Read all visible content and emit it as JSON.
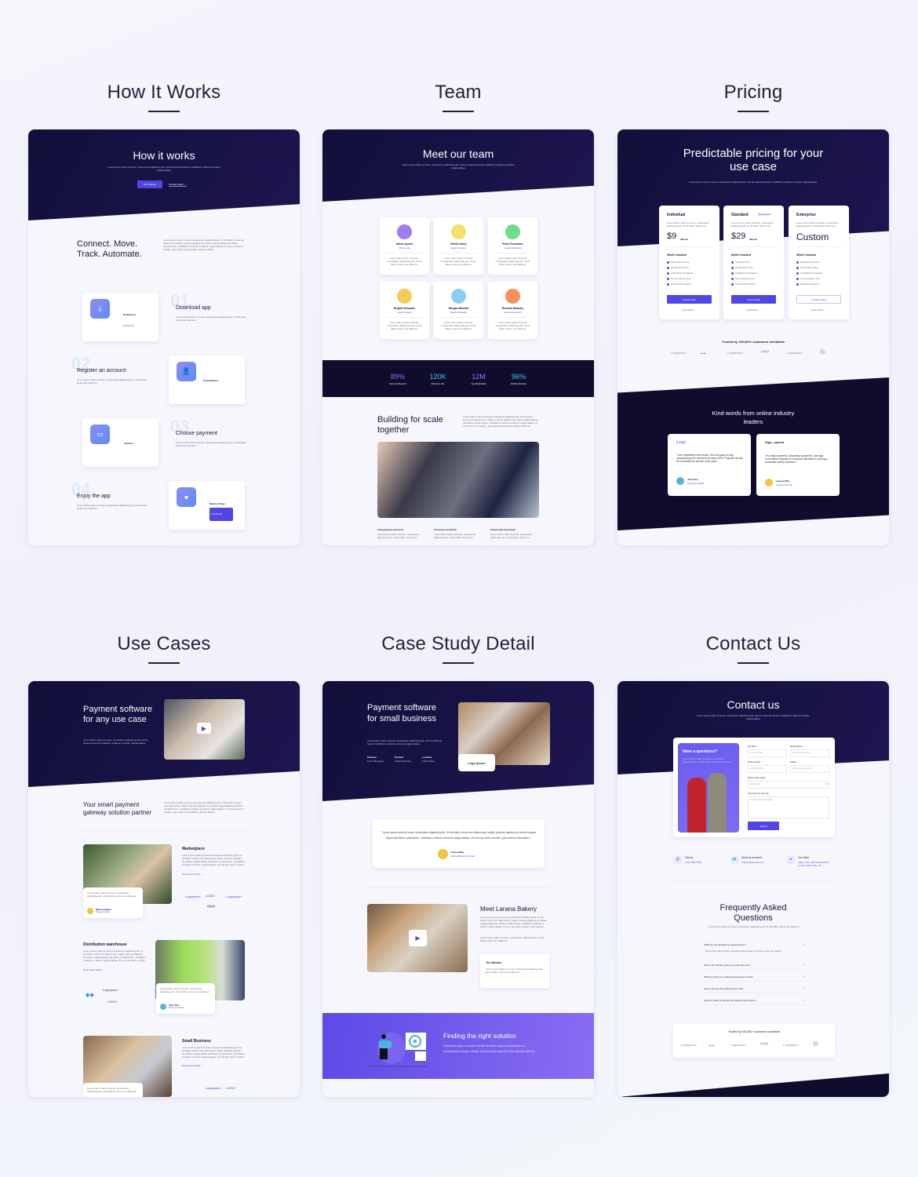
{
  "sections": [
    "How It Works",
    "Team",
    "Pricing",
    "Use Cases",
    "Case Study Detail",
    "Contact Us"
  ],
  "lorem": "Lorem ipsum dolor sit amet, consectetur adipiscing elit, sed do eiusmod tempor incididunt ut labore et dolore magna aliqua.",
  "lorem_long": "Lorem ipsum dolor sit amet consectetur adipiscing elit. Ut elit tellus, luctus nec ullamcorper mattis, pulvinar dapibus leo dolore magna aliqua erat libero condimentum. Incididunt ut labore et dolore magna aliqua. Ut enim ad minim veniam, quis nostrud exercitation ullamco laboris.",
  "lorem_short": "Lorem ipsum dolor sit amet, consectetur adipiscing elit. Ut elit tellus, luctus nec ullamcor.",
  "accent": "#5146e5",
  "how": {
    "title": "How it works",
    "get_started": "Get Started",
    "contact_sales": "Contact Sales →",
    "headline": "Connect. Move. Track. Automate.",
    "steps": [
      {
        "num": "01",
        "title": "Download app",
        "icon": "download-icon"
      },
      {
        "num": "02",
        "title": "Register an account",
        "icon": "user-icon"
      },
      {
        "num": "03",
        "title": "Choose payment",
        "icon": "card-icon"
      },
      {
        "num": "04",
        "title": "Enjoy the app",
        "icon": "heart-icon"
      }
    ],
    "mock": {
      "dashboard": "Dashboard",
      "card_number": "Card Number",
      "invoices": "Invoices",
      "balance": "Balance Page",
      "amount": "$ 1301.20"
    }
  },
  "team": {
    "title": "Meet our team",
    "members": [
      {
        "name": "James Symes",
        "role": "CO-Founder",
        "color": "#a07cf0"
      },
      {
        "name": "Estelle Darcy",
        "role": "Head of Finance",
        "color": "#f5e06a"
      },
      {
        "name": "Pedro Fernandes",
        "role": "Head of Marketing",
        "color": "#6fdc8c"
      },
      {
        "name": "Brigitte Schwartz",
        "role": "Head of Design",
        "color": "#f7c95a"
      },
      {
        "name": "Morgan Maxwell",
        "role": "Head of Manager",
        "color": "#8ecdf3"
      },
      {
        "name": "Rochelle Beaudry",
        "role": "Head of Developer",
        "color": "#f7915a"
      }
    ],
    "stats": [
      {
        "value": "89%",
        "label": "Success Payment"
      },
      {
        "value": "120K",
        "label": "Merchant Join"
      },
      {
        "value": "12M",
        "label": "App Downloads"
      },
      {
        "value": "96%",
        "label": "Positive Reviews"
      }
    ],
    "building": "Building for scale together",
    "values": [
      "Transparency and trust",
      "Customer-Centricity",
      "Ownership and impact"
    ]
  },
  "pricing": {
    "title": "Predictable pricing for your use case",
    "plans": [
      {
        "name": "Individual",
        "price": "$9",
        "per": "/Month",
        "included": "What's included",
        "features": [
          "Personal Account",
          "No Monthly Fees",
          "Cashback Guarantee",
          "No transaction limit",
          "Online 24/7 support"
        ],
        "cta": "Choose Plan",
        "learn": "Learn More →"
      },
      {
        "name": "Standard",
        "badge": "Most popular",
        "price": "$29",
        "per": "/Month",
        "included": "What's included",
        "features": [
          "Team Account",
          "No Monthly Fees",
          "Cashback Guarantee",
          "No transaction limit",
          "Online 24/7 support"
        ],
        "cta": "Choose Plan",
        "learn": "Learn More →"
      },
      {
        "name": "Enterprise",
        "price": "Custom",
        "included": "What's included",
        "features": [
          "Business Account",
          "No Monthly Fees",
          "Cashback Guarantee",
          "No transaction limit",
          "Dedicated support"
        ],
        "cta": "Contact Sales",
        "learn": "Learn More →"
      }
    ],
    "trusted": "Trusted by 152,000+ customers worldwide",
    "logos": [
      "Logoipsum",
      "Logoipsum",
      "Logoipsum"
    ],
    "kind_words": "Kind words from online industry leaders",
    "testimonials": [
      {
        "quote": "\"I am completely blown away. Your company is truly upstanding and is behind its product 100%. Paycash should be nominated for service of the year.\"",
        "name": "John Doe",
        "role": "Larana Founder",
        "logo": "Logo"
      },
      {
        "quote": "\"It's really wonderful. Absolutely wonderful! I strongly recommend Paycash to everyone interested in running a successful online business!\"",
        "name": "Larissa May",
        "role": "Fauget Founder",
        "logo": "logo—ipsum"
      }
    ]
  },
  "usecases": {
    "title": "Payment software for any use case",
    "partner": "Your smart payment gateway solution partner",
    "cases": [
      {
        "title": "Marketplace",
        "link": "Read Case Study →",
        "quote_name": "Marcus Meyer",
        "quote_role": "Fauget Founder"
      },
      {
        "title": "Distribution warehouse",
        "link": "Read Case Study →",
        "quote_name": "John Doe",
        "quote_role": "Hanover Founder"
      },
      {
        "title": "Small Business",
        "link": "Read Case Study →"
      }
    ],
    "logos": [
      "Logoipsum",
      "LOGO",
      "Logoipsum"
    ]
  },
  "casestudy": {
    "title": "Payment software for small business",
    "meta": [
      {
        "label": "Industry",
        "value": "Food & Beverage"
      },
      {
        "label": "Product",
        "value": "Online Payments"
      },
      {
        "label": "Location",
        "value": "United States"
      }
    ],
    "logo": "Logo Ipsum",
    "quote": "\"Lorem ipsum dolor sit amet, consectetur adipiscing elit. Ut elit tellus, luctus nec ullamcorper mattis, pulvinar dapibus leo dolore magna aliqua erat libero condimentu. Incididunt ut labore et dolore magna aliqua. Ut enim ad minim veniam, quis nostrud exercitation.\"",
    "quote_name": "Larissa May",
    "quote_role": "Larana Bakery Founder",
    "meet": "Meet Larana Bakery",
    "mission": "The Mission",
    "finding": "Finding the right solution",
    "finding_desc": "Tanta petere igitur, ne sineres memini fieri etiam aliquam inclinationem ad consequendum minima. Instead, oportet omnino quieti de rebus dialectica differam."
  },
  "contact": {
    "title": "Contact us",
    "have_q": "Have a questions?",
    "fields": {
      "full_name": "Full Name",
      "full_name_ph": "ex. John Tailor",
      "email": "Email address",
      "email_ph": "example@mail.com",
      "phone": "Phone number",
      "phone_ph": "(+62) 8000 800",
      "subject": "Subject",
      "subject_ph": "What is your question?",
      "scope": "Please select scope",
      "scope_val": "Select topic",
      "help": "Tell us how we can help",
      "help_ph": "Add any additional details"
    },
    "submit": "Submit",
    "info": [
      {
        "label": "Call us",
        "value": "(+62) 1829 7298",
        "icon": "phone-icon"
      },
      {
        "label": "Send us an email",
        "value": "support@paycash.com",
        "icon": "mail-icon"
      },
      {
        "label": "Our office",
        "value": "Sutton Yard, 136 Goswell Road, London, EC1V 7DE, UK",
        "icon": "pin-icon"
      }
    ],
    "faq_title": "Frequently Asked Questions",
    "faqs": [
      "What are the admissions requirements ?",
      "How is the transfer process to take the test ?",
      "Where to find your routing and account number",
      "How to choose the right payment rail?",
      "How do I have to submit the required documents ?"
    ],
    "trusted": "Trusted by 152,000+ customers worldwide"
  }
}
